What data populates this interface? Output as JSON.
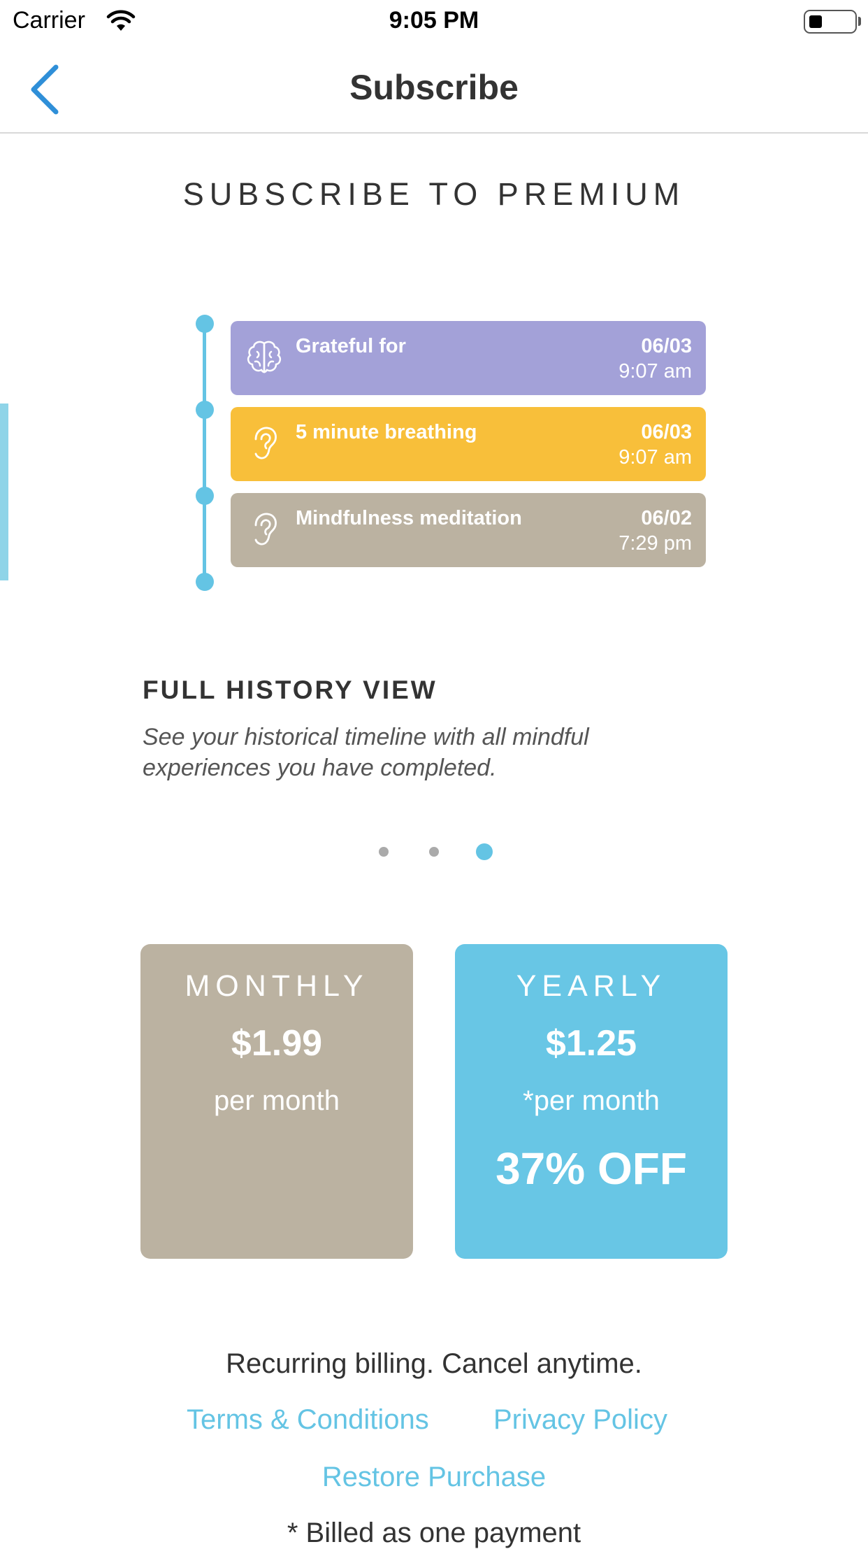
{
  "status_bar": {
    "carrier": "Carrier",
    "time": "9:05 PM"
  },
  "nav": {
    "title": "Subscribe"
  },
  "headline": "SUBSCRIBE TO PREMIUM",
  "timeline": {
    "items": [
      {
        "title": "Grateful for",
        "date": "06/03",
        "time": "9:07 am",
        "icon": "brain-icon",
        "color": "#a3a1d8"
      },
      {
        "title": "5 minute breathing",
        "date": "06/03",
        "time": "9:07 am",
        "icon": "ear-icon",
        "color": "#f8bf3a"
      },
      {
        "title": "Mindfulness meditation",
        "date": "06/02",
        "time": "7:29 pm",
        "icon": "ear-icon",
        "color": "#bbb2a1"
      }
    ]
  },
  "feature": {
    "title": "FULL HISTORY VIEW",
    "description": "See your historical timeline with all mindful experiences you have completed."
  },
  "pager": {
    "count": 3,
    "active_index": 2
  },
  "plans": [
    {
      "name": "MONTHLY",
      "price": "$1.99",
      "per": "per month",
      "discount": "",
      "color": "#bbb2a1"
    },
    {
      "name": "YEARLY",
      "price": "$1.25",
      "per": "*per month",
      "discount": "37% OFF",
      "color": "#68c6e5"
    }
  ],
  "footer": {
    "billing": "Recurring billing. Cancel anytime.",
    "terms": "Terms & Conditions",
    "privacy": "Privacy Policy",
    "restore": "Restore Purchase",
    "billed_note": "* Billed as one payment"
  },
  "colors": {
    "accent": "#64c4e4",
    "back_arrow": "#2f8fd8"
  }
}
